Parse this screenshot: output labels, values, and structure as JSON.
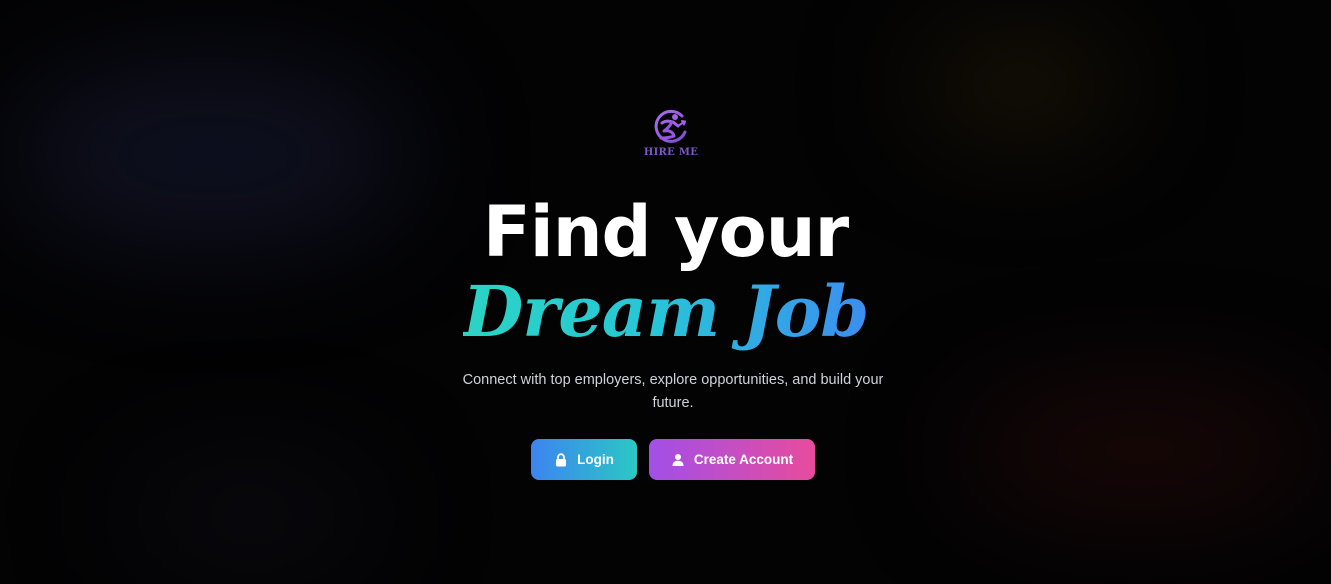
{
  "brand": {
    "logo_icon": "running-person-logo-icon",
    "name": "HIRE ME",
    "color": "#7b57c9"
  },
  "hero": {
    "headline_line1": "Find your",
    "headline_line2": "Dream Job",
    "subtitle": "Connect with top employers, explore opportunities, and build your future."
  },
  "actions": {
    "login": {
      "label": "Login",
      "icon": "lock-icon",
      "gradient": [
        "#3c84f0",
        "#2bc8c4"
      ]
    },
    "create_account": {
      "label": "Create Account",
      "icon": "user-icon",
      "gradient": [
        "#a24fe8",
        "#e84c9c"
      ]
    }
  },
  "colors": {
    "background": "#030304",
    "headline": "#ffffff",
    "accent_gradient": [
      "#2bd4c4",
      "#3c8ef0"
    ]
  }
}
